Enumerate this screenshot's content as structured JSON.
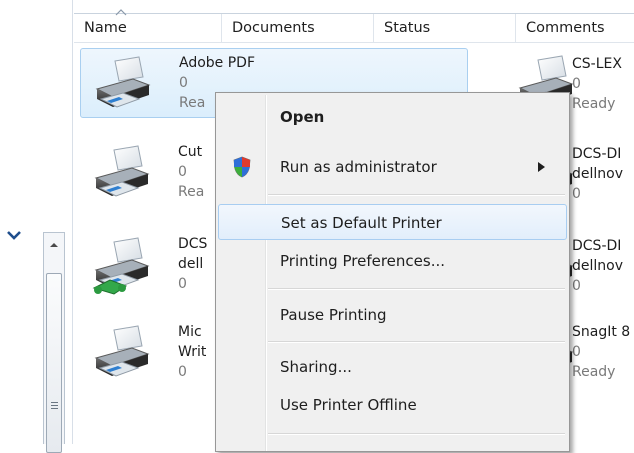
{
  "columns": {
    "name": "Name",
    "documents": "Documents",
    "status": "Status",
    "comments": "Comments"
  },
  "printers": [
    {
      "name": "Adobe PDF",
      "documents": "0",
      "status": "Rea",
      "icon": "printer-icon",
      "selected": true
    },
    {
      "name": "Cut",
      "documents": "0",
      "status": "Rea",
      "icon": "printer-icon"
    },
    {
      "name": "DCS",
      "line2": "dell",
      "documents": "0",
      "icon": "network-printer-icon"
    },
    {
      "name": "Mic",
      "line2": "Writ",
      "documents": "0",
      "icon": "printer-icon"
    }
  ],
  "right_printers": [
    {
      "name": "CS-LEX",
      "documents": "0",
      "status": "Ready"
    },
    {
      "name": "DCS-DI",
      "line2": "dellnov",
      "documents": "0"
    },
    {
      "name": "DCS-DI",
      "line2": "dellnov",
      "documents": "0"
    },
    {
      "name": "SnagIt 8",
      "documents": "0",
      "status": "Ready"
    }
  ],
  "context_menu": {
    "open": "Open",
    "run_as_admin": "Run as administrator",
    "set_default": "Set as Default Printer",
    "preferences": "Printing Preferences...",
    "pause": "Pause Printing",
    "sharing": "Sharing...",
    "offline": "Use Printer Offline"
  },
  "colors": {
    "selection_border": "#a9cff0",
    "menu_background": "#f0f0f0",
    "hover_border": "#a8cdf1"
  }
}
